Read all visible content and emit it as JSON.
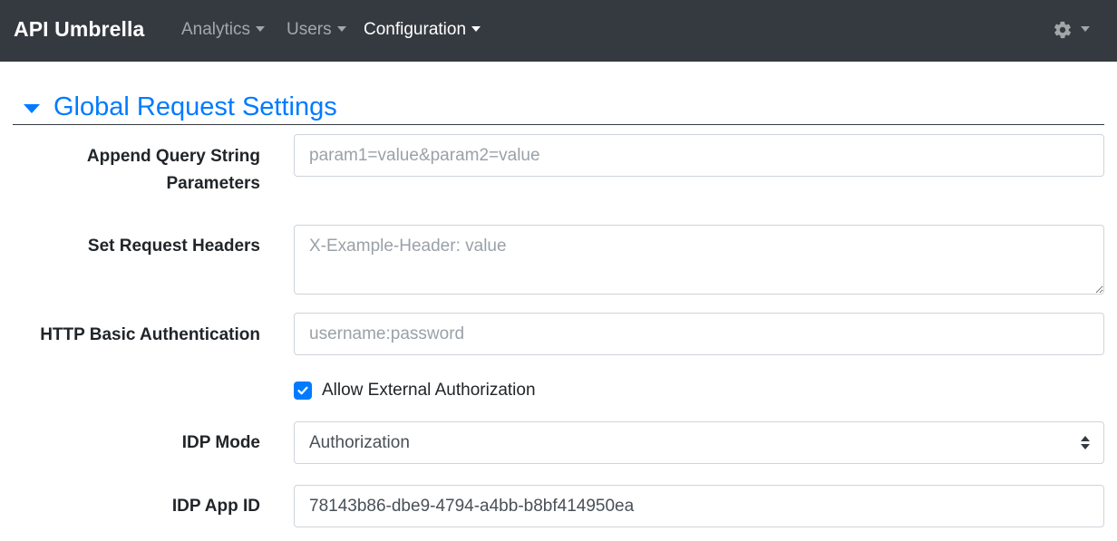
{
  "navbar": {
    "brand": "API Umbrella",
    "items": [
      {
        "label": "Analytics",
        "active": false
      },
      {
        "label": "Users",
        "active": false
      },
      {
        "label": "Configuration",
        "active": true
      }
    ],
    "settings_icon": "gear-icon",
    "bg_color": "#343a40"
  },
  "section": {
    "title": "Global Request Settings",
    "expanded": true,
    "accent_color": "#007bff"
  },
  "form": {
    "append_query": {
      "label_line1": "Append Query String",
      "label_line2": "Parameters",
      "value": "",
      "placeholder": "param1=value&param2=value"
    },
    "request_headers": {
      "label": "Set Request Headers",
      "value": "",
      "placeholder": "X-Example-Header: value"
    },
    "basic_auth": {
      "label": "HTTP Basic Authentication",
      "value": "",
      "placeholder": "username:password"
    },
    "external_auth": {
      "label": "Allow External Authorization",
      "checked": true
    },
    "idp_mode": {
      "label": "IDP Mode",
      "selected": "Authorization"
    },
    "idp_app_id": {
      "label": "IDP App ID",
      "value": "78143b86-dbe9-4794-a4bb-b8bf414950ea"
    }
  }
}
